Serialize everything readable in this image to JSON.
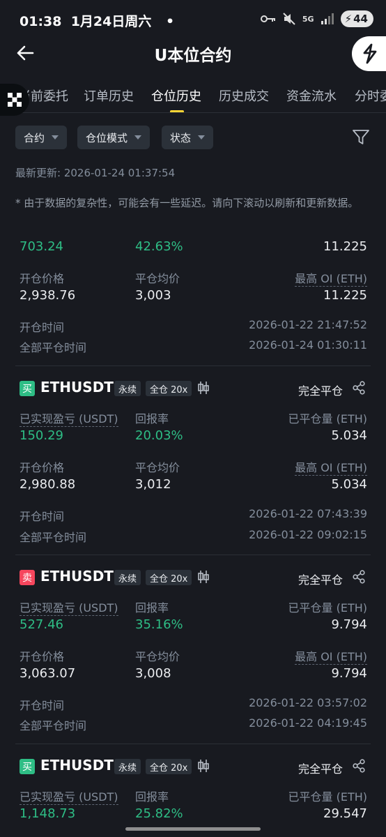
{
  "status_bar": {
    "time_date": "01:38  1月24日周六",
    "dot": "•",
    "network": "5G",
    "battery": "44"
  },
  "header": {
    "title": "U本位合约"
  },
  "tabs": [
    {
      "label": "当前委托"
    },
    {
      "label": "订单历史"
    },
    {
      "label": "仓位历史"
    },
    {
      "label": "历史成交"
    },
    {
      "label": "资金流水"
    },
    {
      "label": "分时委托"
    }
  ],
  "filters": {
    "contract": "合约",
    "position_mode": "仓位模式",
    "status": "状态"
  },
  "last_updated": "最新更新: 2026-01-24 01:37:54",
  "notice": "* 由于数据的复杂性，可能会有一些延迟。请向下滚动以刷新和更新数据。",
  "labels": {
    "realized_pnl": "已实现盈亏 (USDT)",
    "roi": "回报率",
    "closed_qty": "已平仓量 (ETH)",
    "entry_price": "开仓价格",
    "avg_close": "平仓均价",
    "max_oi": "最高 OI (ETH)",
    "open_time": "开仓时间",
    "close_time": "全部平仓时间",
    "perpetual": "永续",
    "cross": "全仓 20x",
    "buy": "买",
    "sell": "卖"
  },
  "partial_card": {
    "pnl": "703.24",
    "roi": "42.63%",
    "closed_qty": "11.225",
    "entry_price": "2,938.76",
    "avg_close": "3,003",
    "max_oi": "11.225",
    "open_time": "2026-01-22 21:47:52",
    "close_time": "2026-01-24 01:30:11"
  },
  "positions": [
    {
      "side": "buy",
      "symbol": "ETHUSDT",
      "status": "完全平仓",
      "pnl": "150.29",
      "roi": "20.03%",
      "closed_qty": "5.034",
      "entry_price": "2,980.88",
      "avg_close": "3,012",
      "max_oi": "5.034",
      "open_time": "2026-01-22 07:43:39",
      "close_time": "2026-01-22 09:02:15"
    },
    {
      "side": "sell",
      "symbol": "ETHUSDT",
      "status": "完全平仓",
      "pnl": "527.46",
      "roi": "35.16%",
      "closed_qty": "9.794",
      "entry_price": "3,063.07",
      "avg_close": "3,008",
      "max_oi": "9.794",
      "open_time": "2026-01-22 03:57:02",
      "close_time": "2026-01-22 04:19:45"
    },
    {
      "side": "buy",
      "symbol": "ETHUSDT",
      "status": "完全平仓",
      "pnl": "1,148.73",
      "roi": "25.82%",
      "closed_qty": "29.547"
    }
  ],
  "colors": {
    "background": "#181a20",
    "profit": "#2ebd85",
    "buy": "#2ebd85",
    "sell": "#f6465d",
    "accent": "#fcd535"
  }
}
